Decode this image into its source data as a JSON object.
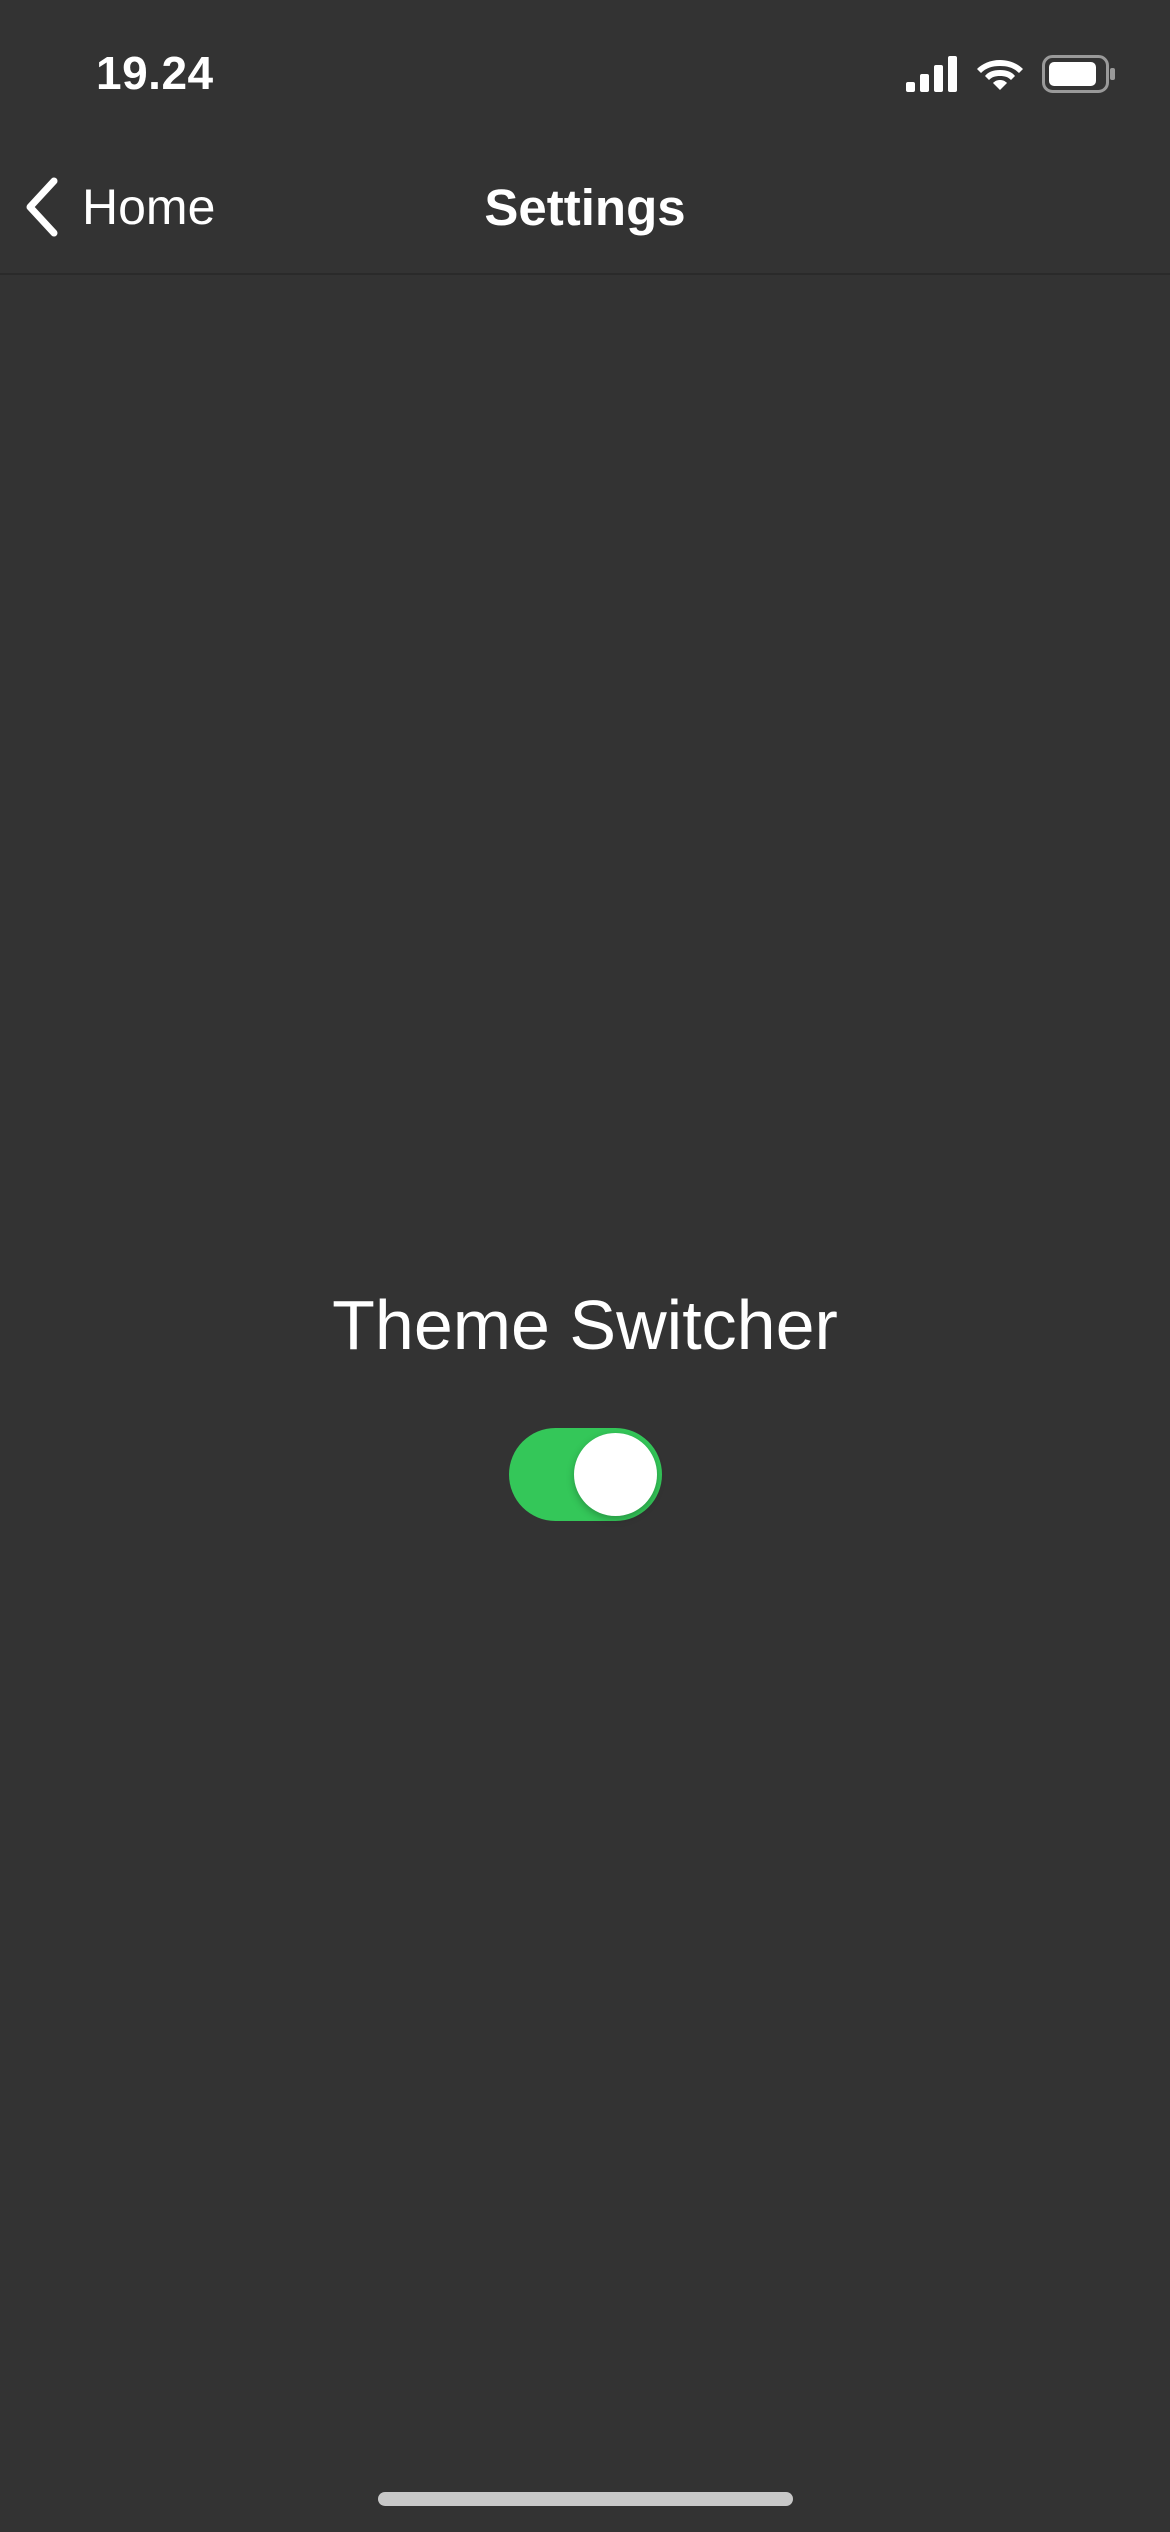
{
  "status_bar": {
    "time": "19.24",
    "signal_icon": "cellular-signal-icon",
    "wifi_icon": "wifi-icon",
    "battery_icon": "battery-icon"
  },
  "nav": {
    "back_label": "Home",
    "back_icon": "chevron-left-icon",
    "title": "Settings"
  },
  "settings": {
    "theme_switcher_label": "Theme Switcher",
    "theme_switcher_on": true
  },
  "colors": {
    "background": "#333333",
    "toggle_on": "#34c759",
    "text": "#ffffff"
  }
}
